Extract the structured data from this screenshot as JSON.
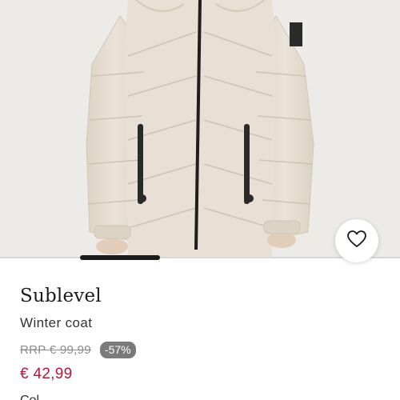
{
  "product": {
    "brand": "Sublevel",
    "name": "Winter coat",
    "rrp": "RRP € 99,99",
    "discount": "-57%",
    "price": "€ 42,99",
    "color_label": "Col"
  },
  "gallery": {
    "current_image_fraction_start": 0.2,
    "current_image_fraction_end": 0.4
  },
  "icons": {
    "wishlist": "heart-icon"
  },
  "colors": {
    "price": "#b5163b",
    "badge": "#7a7a7a",
    "coat": "#e6ddd0"
  }
}
